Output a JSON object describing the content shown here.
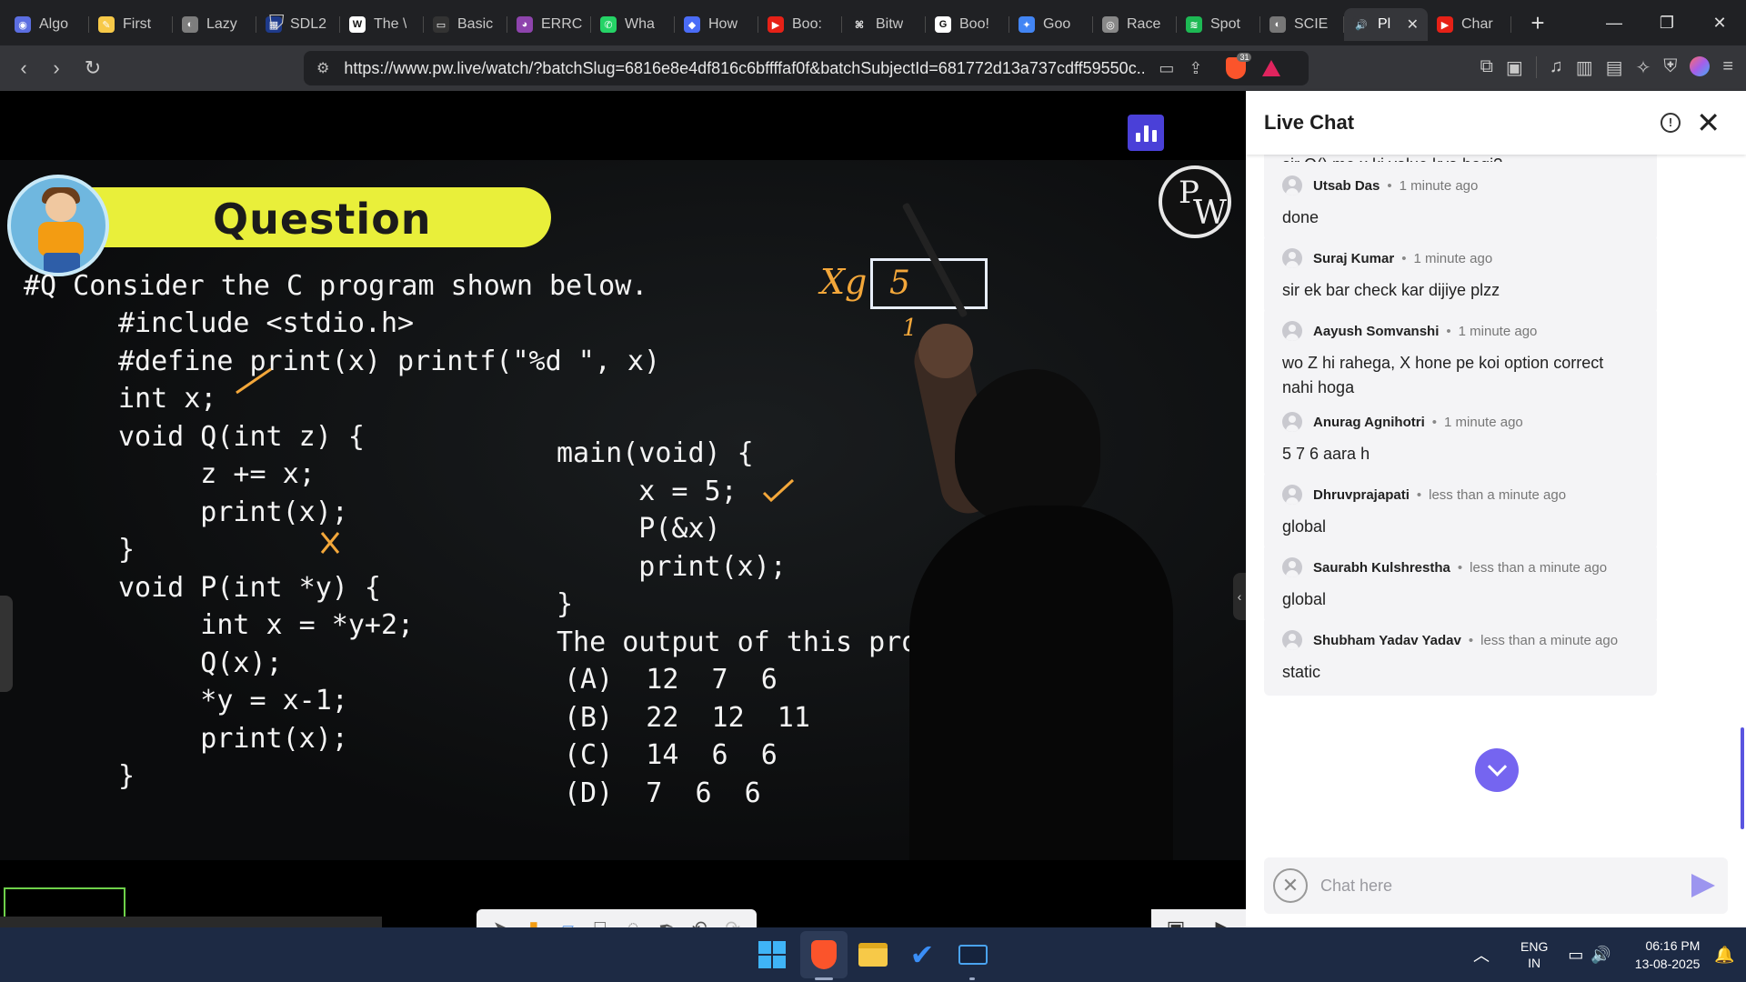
{
  "browser": {
    "tabs": [
      {
        "title": "Algo",
        "color": "#5b6ee1",
        "glyph": "◉"
      },
      {
        "title": "First",
        "color": "#f7c948",
        "glyph": "✎"
      },
      {
        "title": "Lazy",
        "color": "#7d7d7d",
        "glyph": "◐"
      },
      {
        "title": "SDL2",
        "color": "#1e3a8a",
        "glyph": "▦"
      },
      {
        "title": "The \\",
        "color": "#ffffff",
        "glyph": "W"
      },
      {
        "title": "Basic",
        "color": "#333333",
        "glyph": "▭"
      },
      {
        "title": "ERRC",
        "color": "#8e44ad",
        "glyph": "◕"
      },
      {
        "title": "Wha",
        "color": "#25d366",
        "glyph": "✆"
      },
      {
        "title": "How",
        "color": "#4a6cf7",
        "glyph": "◆"
      },
      {
        "title": "Boo:",
        "color": "#e62117",
        "glyph": "▶"
      },
      {
        "title": "Bitw",
        "color": "#202124",
        "glyph": "⌘"
      },
      {
        "title": "Boo!",
        "color": "#ffffff",
        "glyph": "G"
      },
      {
        "title": "Goo",
        "color": "#4285f4",
        "glyph": "✦"
      },
      {
        "title": "Race",
        "color": "#888888",
        "glyph": "◎"
      },
      {
        "title": "Spot",
        "color": "#1db954",
        "glyph": "≋"
      },
      {
        "title": "SCIE",
        "color": "#777777",
        "glyph": "◐"
      },
      {
        "title": "Pl",
        "color": "#35363a",
        "glyph": "🔊",
        "active": true
      },
      {
        "title": "Char",
        "color": "#e62117",
        "glyph": "▶"
      }
    ],
    "url": "https://www.pw.live/watch/?batchSlug=6816e8e4df816c6bffffaf0f&batchSubjectId=681772d13a737cdff59550c...",
    "shield_count": "31"
  },
  "lecture": {
    "banner": "Question",
    "question_line": "#Q Consider the C program shown below.",
    "code_left": [
      "#include <stdio.h>",
      "#define print(x) printf(\"%d \", x)",
      "int x;",
      "void Q(int z) {",
      "     z += x;",
      "     print(x);",
      "}",
      "void P(int *y) {",
      "     int x = *y+2;",
      "     Q(x);",
      "     *y = x-1;",
      "     print(x);",
      "}"
    ],
    "code_right": [
      "main(void) {",
      "     x = 5;",
      "     P(&x)",
      "     print(x);",
      "}",
      "The output of this pro"
    ],
    "options": [
      "(A)  12  7  6",
      "(B)  22  12  11",
      "(C)  14  6  6",
      "(D)  7  6  6"
    ],
    "annotation_var": "Xg",
    "annotation_box_value": "5",
    "annotation_below": "1",
    "logo_text": "PW"
  },
  "chat": {
    "title": "Live Chat",
    "input_placeholder": "Chat here",
    "partial_top_message": "sir Q() me x ki value kya hogi?",
    "messages": [
      {
        "name": "Utsab Das",
        "time": "1 minute ago",
        "text": "done"
      },
      {
        "name": "Suraj Kumar",
        "time": "1 minute ago",
        "text": "sir ek bar check kar dijiye plzz"
      },
      {
        "name": "Aayush Somvanshi",
        "time": "1 minute ago",
        "text": "wo Z hi rahega, X hone pe koi option correct nahi hoga"
      },
      {
        "name": "Anurag Agnihotri",
        "time": "1 minute ago",
        "text": "5 7 6 aara h"
      },
      {
        "name": "Dhruvprajapati",
        "time": "less than a minute ago",
        "text": "global"
      },
      {
        "name": "Saurabh Kulshrestha",
        "time": "less than a minute ago",
        "text": "global"
      },
      {
        "name": "Shubham Yadav Yadav",
        "time": "less than a minute ago",
        "text": "static"
      }
    ]
  },
  "taskbar": {
    "lang": "ENG",
    "region": "IN",
    "time": "06:16 PM",
    "date": "13-08-2025"
  }
}
